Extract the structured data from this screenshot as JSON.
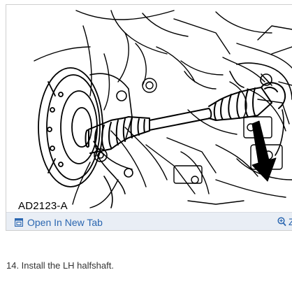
{
  "figure": {
    "code": "AD2123-A"
  },
  "toolbar": {
    "open_tab_label": "Open In New Tab",
    "zoom_label": "Z",
    "open_tab_icon": "external-window-icon",
    "zoom_icon": "magnifier-zoom-icon",
    "link_color": "#2a66b0",
    "bar_color": "#e9eef5"
  },
  "step": {
    "text": "14. Install the LH halfshaft."
  }
}
